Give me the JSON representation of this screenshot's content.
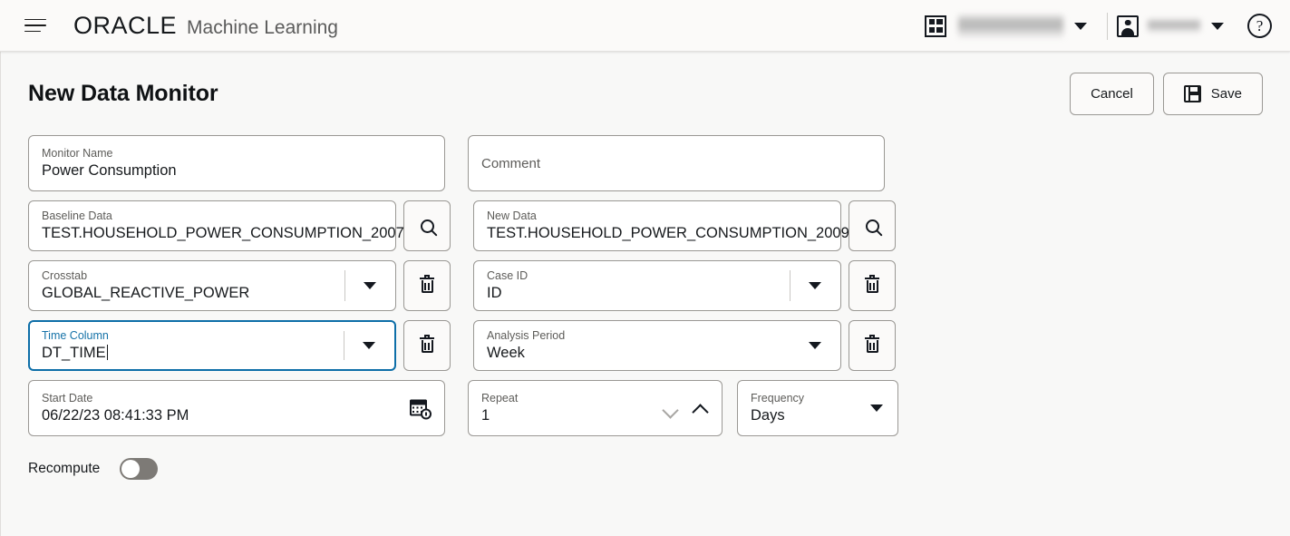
{
  "header": {
    "menu_icon": "hamburger-icon",
    "brand": "ORACLE",
    "brand_sub": "Machine Learning",
    "grid_icon": "grid-apps-icon",
    "tenancy_name": "",
    "user_name": "",
    "help_icon": "?",
    "caret_icon": "chevron-down-icon"
  },
  "page": {
    "title": "New Data Monitor",
    "cancel_label": "Cancel",
    "save_label": "Save",
    "save_icon": "save-floppy-icon"
  },
  "form": {
    "monitor_name": {
      "label": "Monitor Name",
      "value": "Power Consumption"
    },
    "comment": {
      "label": "Comment",
      "placeholder": "Comment",
      "value": ""
    },
    "baseline_data": {
      "label": "Baseline Data",
      "value": "TEST.HOUSEHOLD_POWER_CONSUMPTION_2007",
      "action_icon": "search-icon"
    },
    "new_data": {
      "label": "New Data",
      "value": "TEST.HOUSEHOLD_POWER_CONSUMPTION_2009",
      "action_icon": "search-icon"
    },
    "crosstab": {
      "label": "Crosstab",
      "value": "GLOBAL_REACTIVE_POWER",
      "action_icon": "trash-icon"
    },
    "case_id": {
      "label": "Case ID",
      "value": "ID",
      "action_icon": "trash-icon"
    },
    "time_column": {
      "label": "Time Column",
      "value": "DT_TIME",
      "focused": true,
      "action_icon": "trash-icon"
    },
    "analysis_period": {
      "label": "Analysis Period",
      "value": "Week",
      "action_icon": "trash-icon"
    },
    "start_date": {
      "label": "Start Date",
      "value": "06/22/23 08:41:33 PM",
      "action_icon": "calendar-clock-icon"
    },
    "repeat": {
      "label": "Repeat",
      "value": "1",
      "decrement_icon": "chevron-down-icon",
      "increment_icon": "chevron-up-icon"
    },
    "frequency": {
      "label": "Frequency",
      "value": "Days"
    },
    "recompute": {
      "label": "Recompute",
      "state": "off"
    }
  },
  "colors": {
    "focus_blue": "#0d6ea8",
    "label_blue": "#1572a8",
    "page_bg": "#f8f8f7",
    "field_border": "#9a9894",
    "toggle_off": "#7d7a76"
  }
}
